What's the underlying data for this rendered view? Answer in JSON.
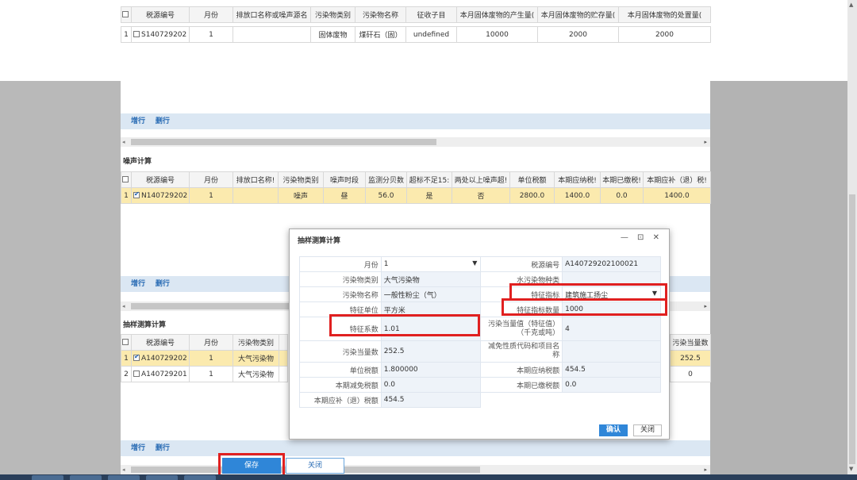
{
  "top_grid": {
    "headers": [
      "",
      "税源编号",
      "月份",
      "排放口名称或噪声源名",
      "污染物类别",
      "污染物名称",
      "征收子目",
      "本月固体废物的产生量(",
      "本月固体废物的贮存量(",
      "本月固体废物的处置量("
    ],
    "rows": [
      [
        "1",
        "S140729202",
        "1",
        "",
        "固体废物",
        "煤矸石（固）",
        "undefined",
        "10000",
        "2000",
        "2000"
      ]
    ]
  },
  "toolbar1": {
    "add": "增行",
    "delete": "删行"
  },
  "noise": {
    "title": "噪声计算",
    "headers": [
      "",
      "税源编号",
      "月份",
      "排放口名称!",
      "污染物类别",
      "噪声时段",
      "监测分贝数",
      "超标不足15:",
      "两处以上噪声超!",
      "单位税额",
      "本期应纳税!",
      "本期已缴税!",
      "本期应补（退）税!"
    ],
    "rows": [
      [
        "1",
        "N140729202",
        "1",
        "",
        "噪声",
        "昼",
        "56.0",
        "是",
        "否",
        "2800.0",
        "1400.0",
        "0.0",
        "1400.0"
      ]
    ]
  },
  "toolbar2": {
    "add": "增行",
    "delete": "删行"
  },
  "sampling": {
    "title": "抽样测算计算",
    "headers": [
      "",
      "税源编号",
      "月份",
      "污染物类别",
      "污染当量数"
    ],
    "rows": [
      [
        "1",
        "A140729202",
        "1",
        "大气污染物",
        "252.5"
      ],
      [
        "2",
        "A140729201",
        "1",
        "大气污染物",
        "0"
      ]
    ]
  },
  "toolbar3": {
    "add": "增行",
    "delete": "删行"
  },
  "bottom": {
    "save": "保存",
    "close": "关闭"
  },
  "modal": {
    "title": "抽样测算计算",
    "controls": "— ⊡ ✕",
    "month_label": "月份",
    "month_value": "1",
    "source_no_label": "税源编号",
    "source_no_value": "A140729202100021",
    "pollutant_cat_label": "污染物类别",
    "pollutant_cat_value": "大气污染物",
    "water_kind_label": "水污染物种类",
    "water_kind_value": "",
    "pollutant_name_label": "污染物名称",
    "pollutant_name_value": "一般性粉尘（气）",
    "feature_index_label": "特征指标",
    "feature_index_value": "建筑施工扬尘",
    "feature_unit_label": "特征单位",
    "feature_unit_value": "平方米",
    "feature_count_label": "特征指标数量",
    "feature_count_value": "1000",
    "feature_coef_label": "特征系数",
    "feature_coef_value": "1.01",
    "equiv_value_label": "污染当量值（特征值）（千克或吨）",
    "equiv_value_value": "4",
    "equiv_count_label": "污染当量数",
    "equiv_count_value": "252.5",
    "relief_code_label": "减免性质代码和项目名称",
    "relief_code_value": "",
    "unit_tax_label": "单位税额",
    "unit_tax_value": "1.800000",
    "payable_label": "本期应纳税额",
    "payable_value": "454.5",
    "relief_amount_label": "本期减免税额",
    "relief_amount_value": "0.0",
    "paid_label": "本期已缴税额",
    "paid_value": "0.0",
    "refund_label": "本期应补（退）税额",
    "refund_value": "454.5",
    "confirm": "确认",
    "close": "关闭"
  }
}
